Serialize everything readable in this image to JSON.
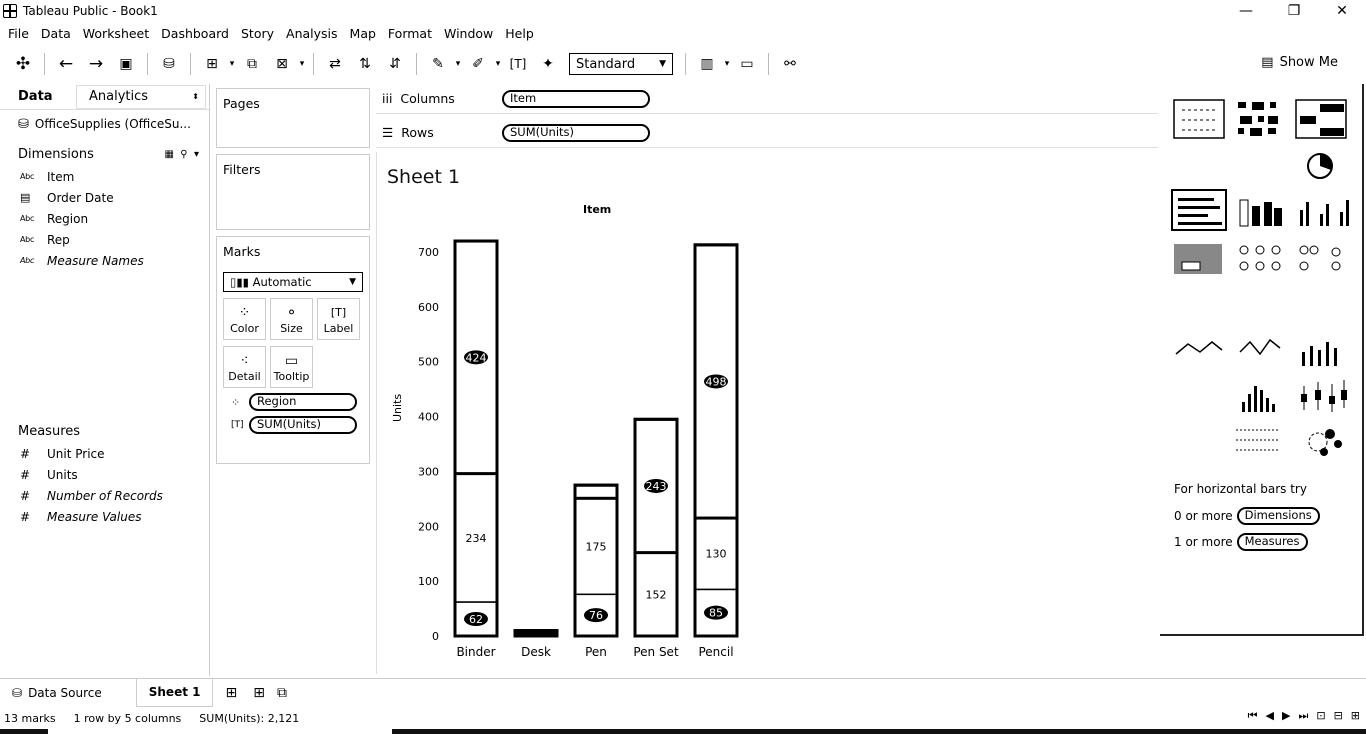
{
  "window": {
    "title": "Tableau Public - Book1",
    "controls": [
      "—",
      "❐",
      "✕"
    ]
  },
  "menu": [
    "File",
    "Data",
    "Worksheet",
    "Dashboard",
    "Story",
    "Analysis",
    "Map",
    "Format",
    "Window",
    "Help"
  ],
  "toolbar": {
    "fit_select": "Standard",
    "show_me": "Show Me"
  },
  "data_pane": {
    "tab_data": "Data",
    "tab_analytics": "Analytics",
    "datasource": "OfficeSupplies (OfficeSu...",
    "dimensions_label": "Dimensions",
    "dimensions": [
      {
        "type": "Abc",
        "name": "Item"
      },
      {
        "type": "date",
        "name": "Order Date"
      },
      {
        "type": "Abc",
        "name": "Region"
      },
      {
        "type": "Abc",
        "name": "Rep"
      },
      {
        "type": "Abc",
        "name": "Measure Names"
      }
    ],
    "measures_label": "Measures",
    "measures": [
      {
        "type": "#",
        "name": "Unit Price"
      },
      {
        "type": "#",
        "name": "Units"
      },
      {
        "type": "#",
        "name": "Number of Records"
      },
      {
        "type": "#",
        "name": "Measure Values"
      }
    ]
  },
  "cards": {
    "pages": "Pages",
    "filters": "Filters",
    "marks": "Marks",
    "mark_type": "Automatic",
    "mark_buttons": [
      {
        "label": "Color",
        "icon": "color-icon"
      },
      {
        "label": "Size",
        "icon": "size-icon"
      },
      {
        "label": "Label",
        "icon": "label-icon"
      },
      {
        "label": "Detail",
        "icon": "detail-icon"
      },
      {
        "label": "Tooltip",
        "icon": "tooltip-icon"
      }
    ],
    "mark_pills": [
      {
        "icon": "color-dots-icon",
        "label": "Region"
      },
      {
        "icon": "text-icon",
        "label": "SUM(Units)"
      }
    ]
  },
  "shelves": {
    "columns_label": "Columns",
    "columns_pill": "Item",
    "rows_label": "Rows",
    "rows_pill": "SUM(Units)"
  },
  "sheet": {
    "title": "Sheet 1",
    "column_header": "Item"
  },
  "chart_data": {
    "type": "bar",
    "stacked": true,
    "title": "",
    "xlabel": "",
    "ylabel": "Units",
    "ylim": [
      0,
      720
    ],
    "yticks": [
      0,
      100,
      200,
      300,
      400,
      500,
      600,
      700
    ],
    "categories": [
      "Binder",
      "Desk",
      "Pen",
      "Pen Set",
      "Pencil"
    ],
    "segments": [
      [
        {
          "value": 62,
          "label": "62"
        },
        {
          "value": 234,
          "label": "234"
        },
        {
          "value": 424,
          "label": "424"
        }
      ],
      [
        {
          "value": 10,
          "label": ""
        }
      ],
      [
        {
          "value": 76,
          "label": "76"
        },
        {
          "value": 175,
          "label": "175"
        },
        {
          "value": 24,
          "label": ""
        }
      ],
      [
        {
          "value": 152,
          "label": "152"
        },
        {
          "value": 243,
          "label": "243"
        }
      ],
      [
        {
          "value": 85,
          "label": "85"
        },
        {
          "value": 130,
          "label": "130"
        },
        {
          "value": 498,
          "label": "498"
        }
      ]
    ]
  },
  "show_me": {
    "hint_title": "For horizontal bars try",
    "hint_rows": [
      {
        "prefix": "0 or more",
        "pill": "Dimensions"
      },
      {
        "prefix": "1 or more",
        "pill": "Measures"
      }
    ]
  },
  "bottom": {
    "data_source": "Data Source",
    "sheet_tab": "Sheet 1"
  },
  "status": {
    "marks": "13 marks",
    "dims": "1 row by 5 columns",
    "sum": "SUM(Units): 2,121"
  }
}
